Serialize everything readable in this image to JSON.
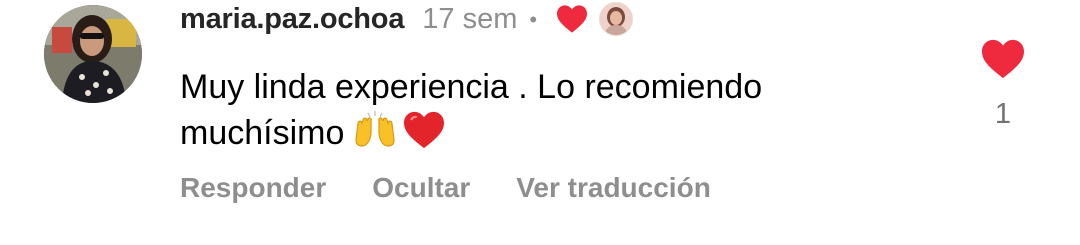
{
  "comment": {
    "username": "maria.paz.ochoa",
    "time_ago": "17 sem",
    "separator": "•",
    "text_line1": "Muy linda experiencia . Lo recomiendo",
    "text_line2": "muchísimo",
    "emojis": [
      "raising-hands-emoji",
      "red-heart-emoji"
    ],
    "creator_liked": true,
    "like_count": "1",
    "liked": true
  },
  "actions": {
    "reply_label": "Responder",
    "hide_label": "Ocultar",
    "translate_label": "Ver traducción"
  },
  "colors": {
    "heart_red": "#ef2a3f",
    "username": "#262626",
    "muted": "#8e8e8e",
    "text": "#000000"
  },
  "icons": {
    "like": "heart-filled-icon",
    "creator_like": "heart-small-icon"
  }
}
